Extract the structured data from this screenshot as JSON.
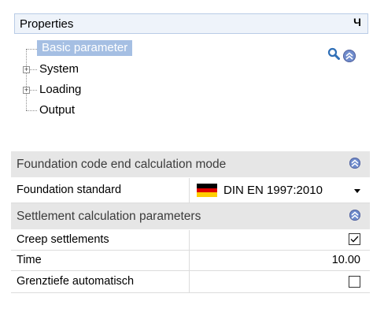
{
  "panel": {
    "title": "Properties",
    "pin_glyph": "Ч"
  },
  "tree": {
    "items": [
      {
        "label": "Basic parameter",
        "selected": true,
        "expandable": false
      },
      {
        "label": "System",
        "selected": false,
        "expandable": true
      },
      {
        "label": "Loading",
        "selected": false,
        "expandable": true
      },
      {
        "label": "Output",
        "selected": false,
        "expandable": false
      }
    ],
    "icons": [
      "search-icon",
      "collapse-icon"
    ]
  },
  "sections": [
    {
      "title": "Foundation code end calculation mode",
      "rows": [
        {
          "name": "Foundation standard",
          "value": "DIN EN 1997:2010",
          "type": "dropdown",
          "flag": "germany-flag"
        }
      ]
    },
    {
      "title": "Settlement calculation parameters",
      "rows": [
        {
          "name": "Creep settlements",
          "type": "checkbox",
          "checked": true
        },
        {
          "name": "Time",
          "type": "number",
          "value": "10.00"
        },
        {
          "name": "Grenztiefe automatisch",
          "type": "checkbox",
          "checked": false
        }
      ]
    }
  ],
  "colors": {
    "selection": "#a5bfe3",
    "section_bg": "#e6e6e6",
    "accent": "#6f8ccd"
  }
}
